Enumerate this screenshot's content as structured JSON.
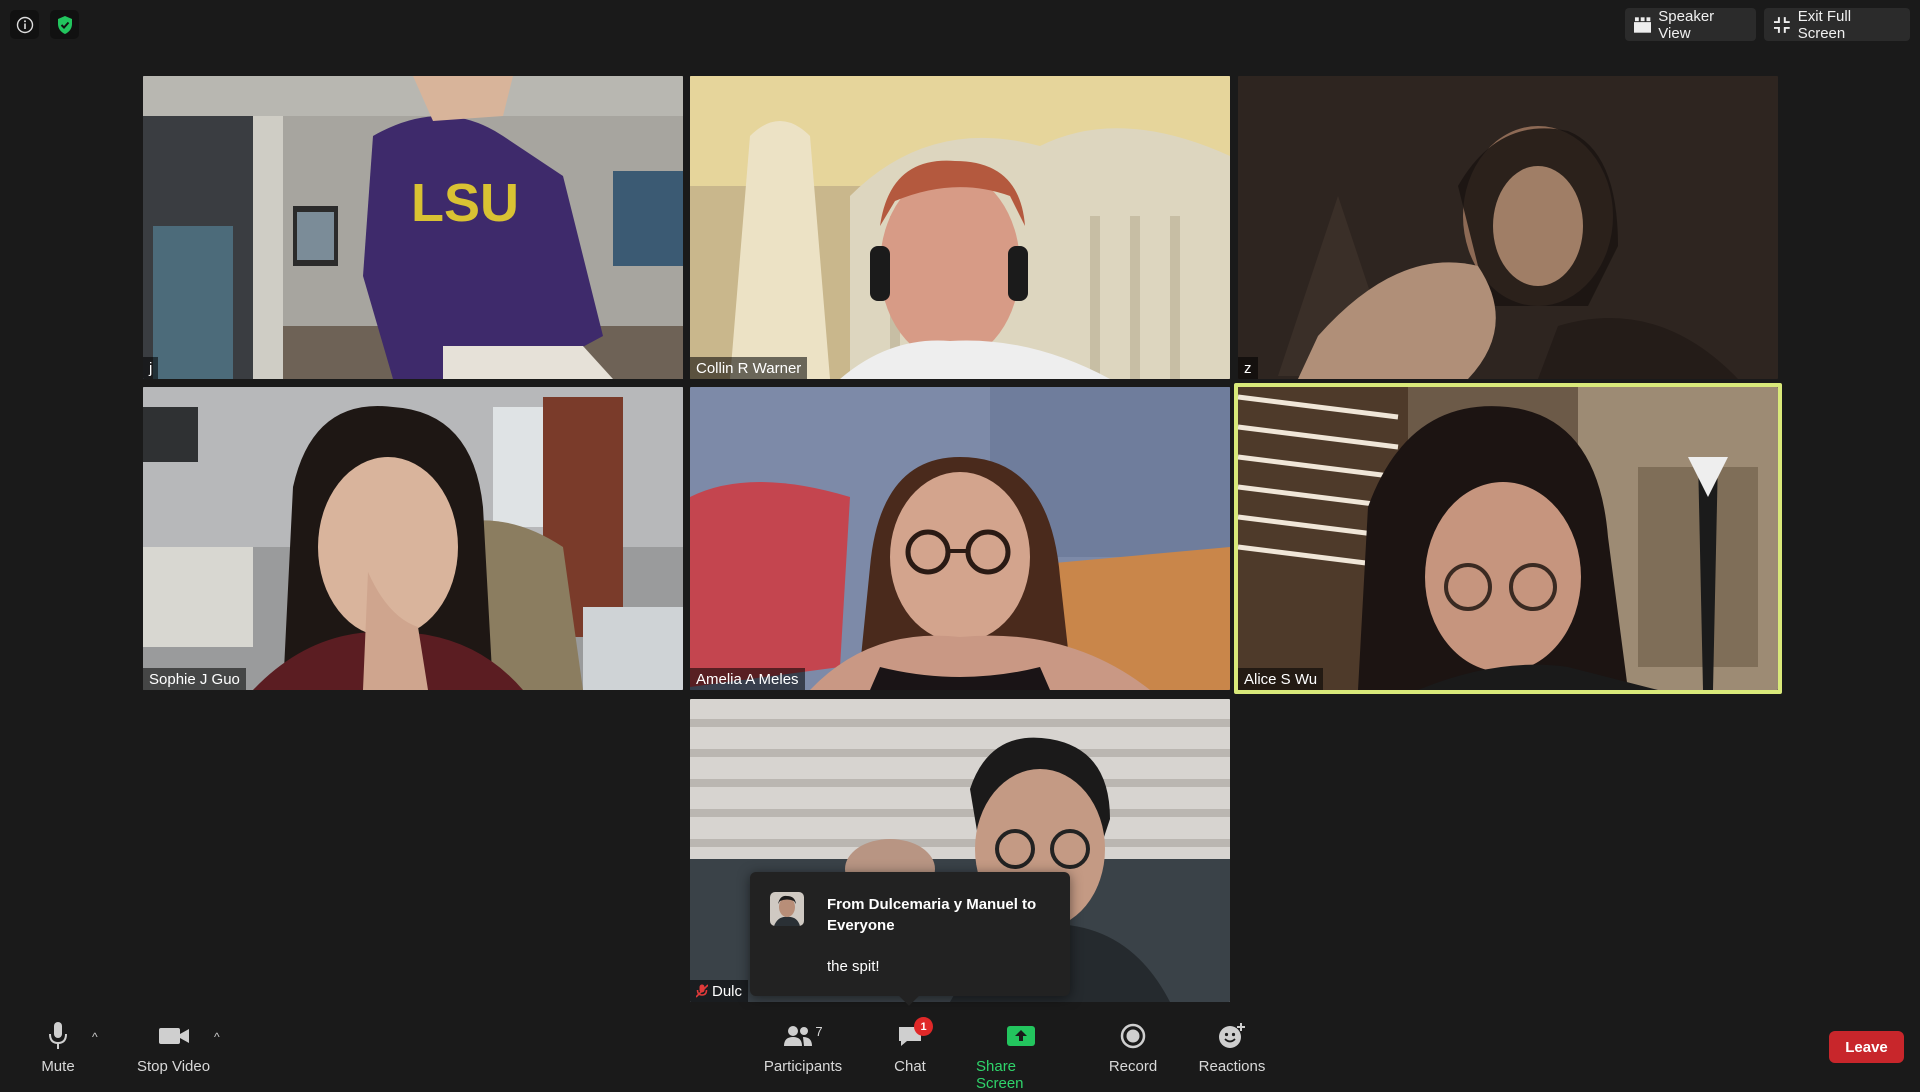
{
  "top": {
    "info_icon": "info-icon",
    "security_icon": "shield-check-icon",
    "speaker_view_label": "Speaker View",
    "exit_fullscreen_label": "Exit Full Screen"
  },
  "participants": [
    {
      "name": "j",
      "active": false
    },
    {
      "name": "Collin R Warner",
      "active": false
    },
    {
      "name": "z",
      "active": false
    },
    {
      "name": "Sophie J Guo",
      "active": false
    },
    {
      "name": "Amelia A Meles",
      "active": false
    },
    {
      "name": "Alice S Wu",
      "active": true
    },
    {
      "name": "Dulc",
      "active": false,
      "muted": true
    }
  ],
  "chat_toast": {
    "from": "From Dulcemaria y Manuel to Everyone",
    "message": "the spit!"
  },
  "toolbar": {
    "mute_label": "Mute",
    "stop_video_label": "Stop Video",
    "participants_label": "Participants",
    "participants_count": "7",
    "chat_label": "Chat",
    "chat_badge": "1",
    "share_screen_label": "Share Screen",
    "record_label": "Record",
    "reactions_label": "Reactions",
    "leave_label": "Leave"
  },
  "colors": {
    "background": "#1a1a1a",
    "active_speaker_border": "#d9e97a",
    "share_green": "#23c55e",
    "leave_red": "#c8262b",
    "badge_red": "#e02828"
  }
}
